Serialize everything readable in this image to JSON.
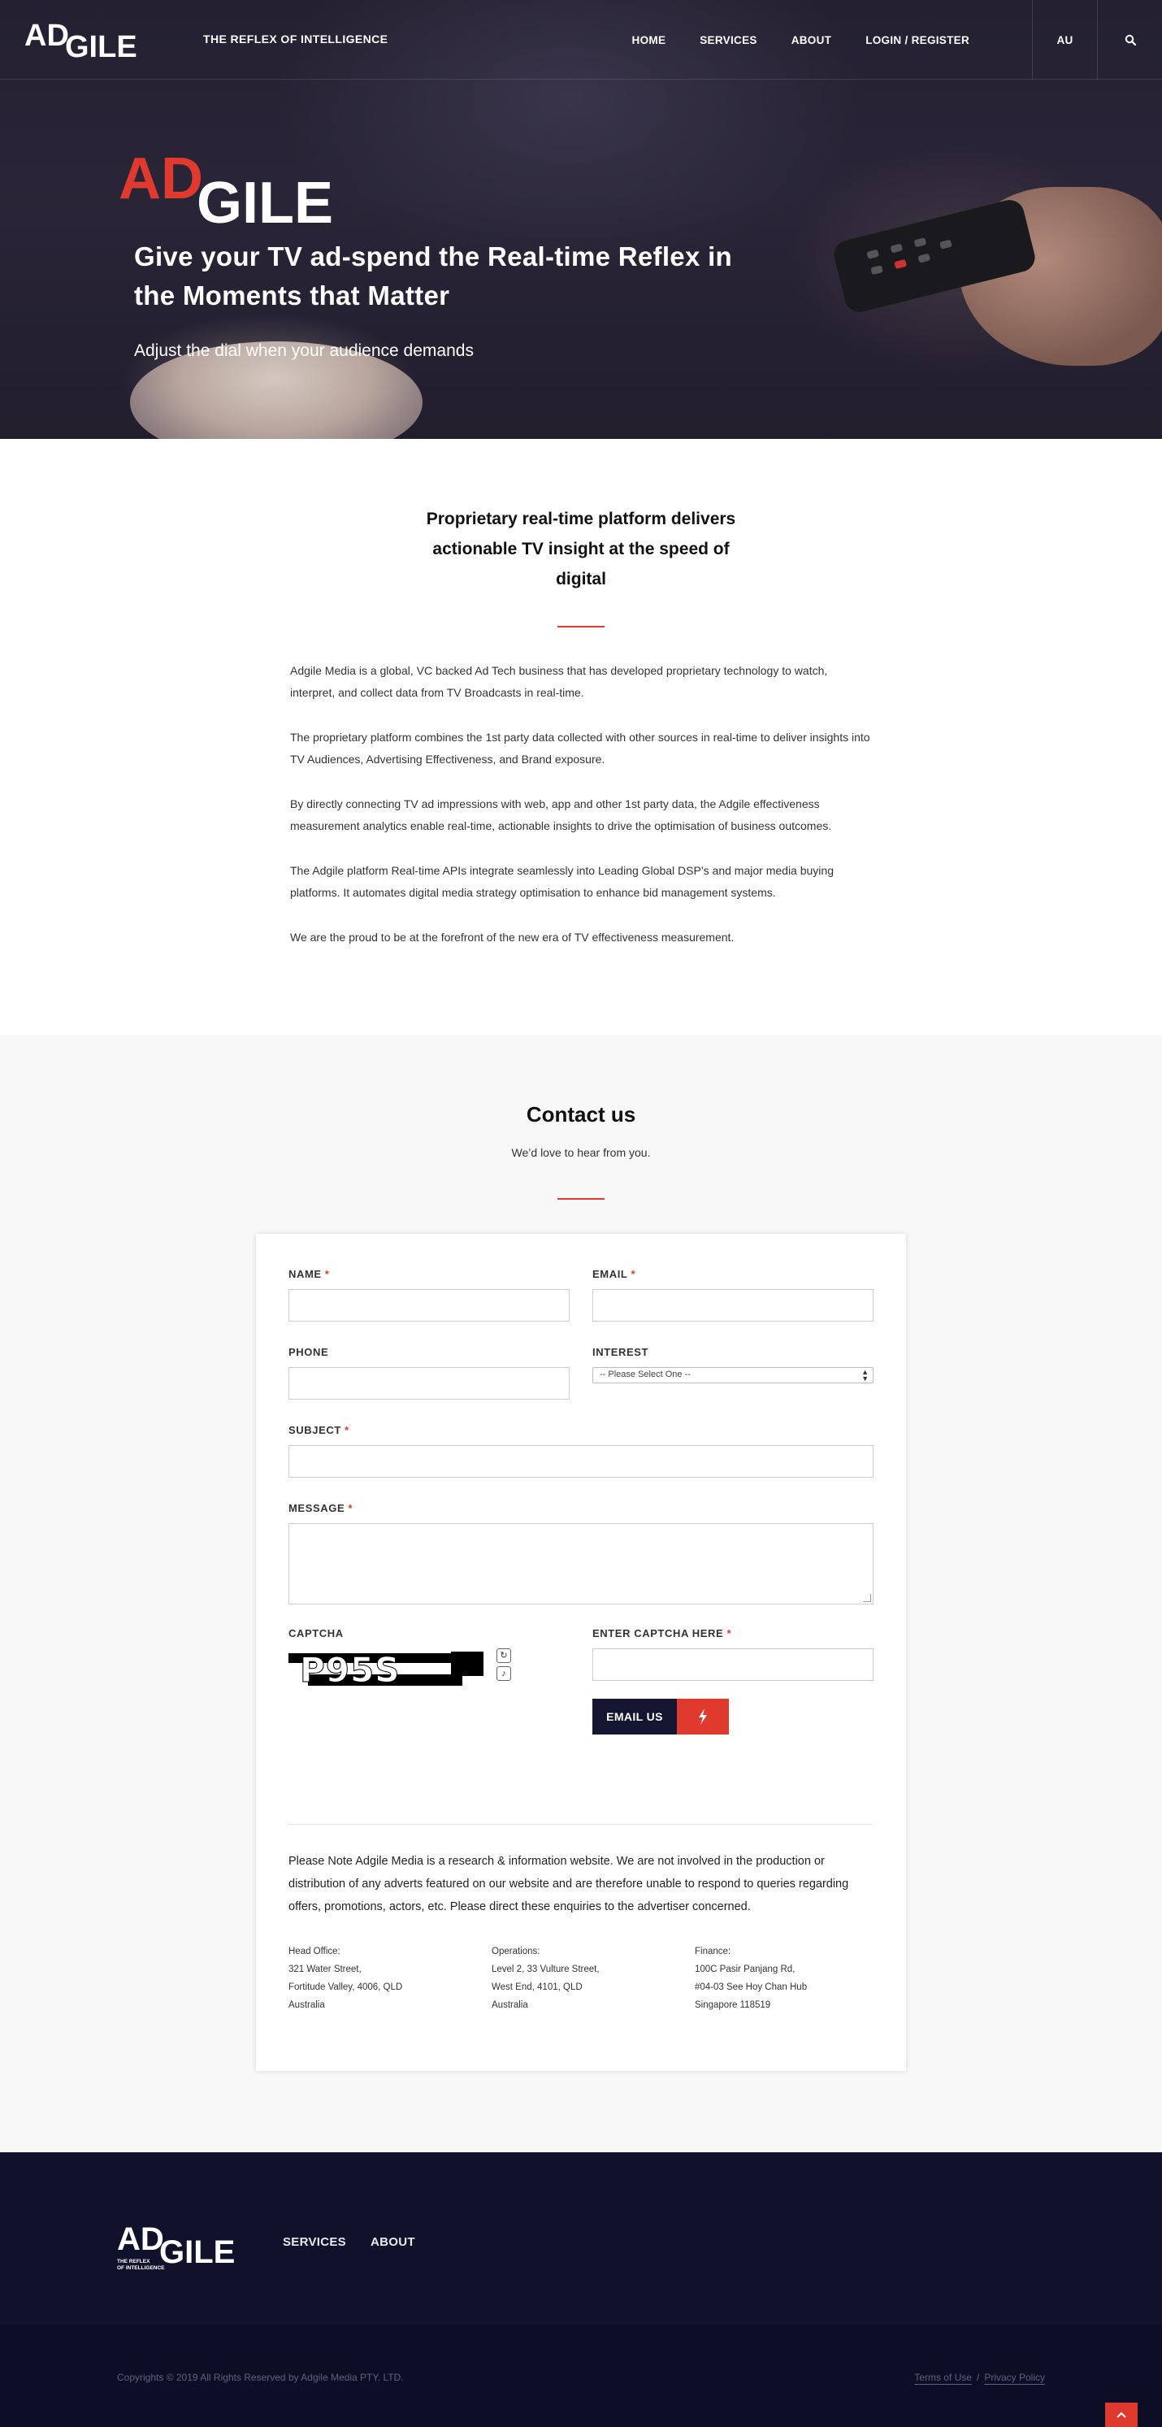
{
  "brand": {
    "logo_ad": "AD",
    "logo_gile": "GILE",
    "tagline": "THE REFLEX OF INTELLIGENCE",
    "accent": "#e03a2e",
    "navy": "#141631"
  },
  "nav": {
    "home": "HOME",
    "services": "SERVICES",
    "about": "ABOUT",
    "login": "LOGIN / REGISTER",
    "region": "AU",
    "search_icon": "search-icon"
  },
  "hero": {
    "title": "Give your TV ad-spend the Real-time Reflex in the Moments that Matter",
    "subtitle": "Adjust the dial when your audience demands"
  },
  "about": {
    "title": "Proprietary real-time platform delivers actionable TV insight at the speed of digital",
    "paragraphs": [
      "Adgile Media is a global, VC backed Ad Tech business that has developed proprietary technology to watch, interpret, and collect data from TV Broadcasts in real-time.",
      "The proprietary platform combines the 1st party data collected with other sources in real-time to deliver insights into TV Audiences, Advertising Effectiveness, and Brand exposure.",
      "By directly connecting TV ad impressions with web, app and other 1st party data, the Adgile effectiveness measurement analytics enable real-time, actionable insights to drive the optimisation of business outcomes.",
      "The Adgile platform Real-time APIs integrate seamlessly into Leading Global DSP’s and major media buying platforms. It automates digital media strategy optimisation to enhance bid management systems.",
      "We are the proud to be at the forefront of the new era of TV effectiveness measurement."
    ]
  },
  "contact": {
    "title": "Contact us",
    "subtitle": "We’d love to hear from you.",
    "form": {
      "name_label": "NAME",
      "email_label": "EMAIL",
      "phone_label": "PHONE",
      "interest_label": "INTEREST",
      "interest_selected": "-- Please Select One --",
      "subject_label": "SUBJECT",
      "message_label": "MESSAGE",
      "captcha_label": "CAPTCHA",
      "captcha_text": "P95S",
      "captcha_entry_label": "ENTER CAPTCHA HERE",
      "required_mark": "*",
      "submit_label": "EMAIL US",
      "submit_icon": "lightning-icon"
    },
    "note": "Please Note Adgile Media is a research & information website. We are not involved in the production or distribution of any adverts featured on our website and are therefore unable to respond to queries regarding offers, promotions, actors, etc. Please direct these enquiries to the advertiser concerned.",
    "offices": [
      {
        "title": "Head Office:",
        "lines": [
          "321 Water Street,",
          "Fortitude Valley, 4006, QLD",
          "Australia"
        ]
      },
      {
        "title": "Operations:",
        "lines": [
          "Level 2, 33 Vulture Street,",
          "West End, 4101, QLD",
          "Australia"
        ]
      },
      {
        "title": "Finance:",
        "lines": [
          "100C Pasir Panjang Rd,",
          "#04-03 See Hoy Chan Hub",
          "Singapore 118519"
        ]
      }
    ]
  },
  "footer": {
    "logo_tagline_1": "THE REFLEX",
    "logo_tagline_2": "OF INTELLIGENCE",
    "services": "SERVICES",
    "about": "ABOUT",
    "copyright": "Copyrights © 2019 All Rights Reserved by Adgile Media PTY. LTD.",
    "terms": "Terms of Use",
    "separator": "/",
    "privacy": "Privacy Policy",
    "to_top_icon": "chevron-up-icon"
  }
}
